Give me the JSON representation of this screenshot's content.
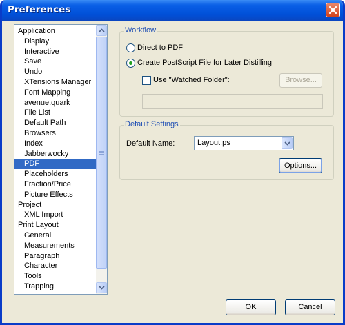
{
  "window": {
    "title": "Preferences"
  },
  "sidebar": {
    "items": [
      {
        "label": "Application",
        "indent": 0
      },
      {
        "label": "Display",
        "indent": 1
      },
      {
        "label": "Interactive",
        "indent": 1
      },
      {
        "label": "Save",
        "indent": 1
      },
      {
        "label": "Undo",
        "indent": 1
      },
      {
        "label": "XTensions Manager",
        "indent": 1
      },
      {
        "label": "Font Mapping",
        "indent": 1
      },
      {
        "label": "avenue.quark",
        "indent": 1
      },
      {
        "label": "File List",
        "indent": 1
      },
      {
        "label": "Default Path",
        "indent": 1
      },
      {
        "label": "Browsers",
        "indent": 1
      },
      {
        "label": "Index",
        "indent": 1
      },
      {
        "label": "Jabberwocky",
        "indent": 1
      },
      {
        "label": "PDF",
        "indent": 1,
        "selected": true
      },
      {
        "label": "Placeholders",
        "indent": 1
      },
      {
        "label": "Fraction/Price",
        "indent": 1
      },
      {
        "label": "Picture Effects",
        "indent": 1
      },
      {
        "label": "Project",
        "indent": 0
      },
      {
        "label": "XML Import",
        "indent": 1
      },
      {
        "label": "Print Layout",
        "indent": 0
      },
      {
        "label": "General",
        "indent": 1
      },
      {
        "label": "Measurements",
        "indent": 1
      },
      {
        "label": "Paragraph",
        "indent": 1
      },
      {
        "label": "Character",
        "indent": 1
      },
      {
        "label": "Tools",
        "indent": 1
      },
      {
        "label": "Trapping",
        "indent": 1
      }
    ]
  },
  "workflow": {
    "group_label": "Workflow",
    "direct_to_pdf_label": "Direct to PDF",
    "create_postscript_label": "Create PostScript File for Later Distilling",
    "selected_option": "create_postscript",
    "use_watched_folder_label": "Use \"Watched Folder\":",
    "use_watched_folder_checked": false,
    "browse_label": "Browse...",
    "watched_folder_path": ""
  },
  "default_settings": {
    "group_label": "Default Settings",
    "default_name_label": "Default Name:",
    "default_name_value": "Layout.ps",
    "options_label": "Options..."
  },
  "footer": {
    "ok_label": "OK",
    "cancel_label": "Cancel"
  },
  "colors": {
    "selection": "#316ac5",
    "title_bar": "#0050d8",
    "group_label": "#1f4fb4"
  }
}
